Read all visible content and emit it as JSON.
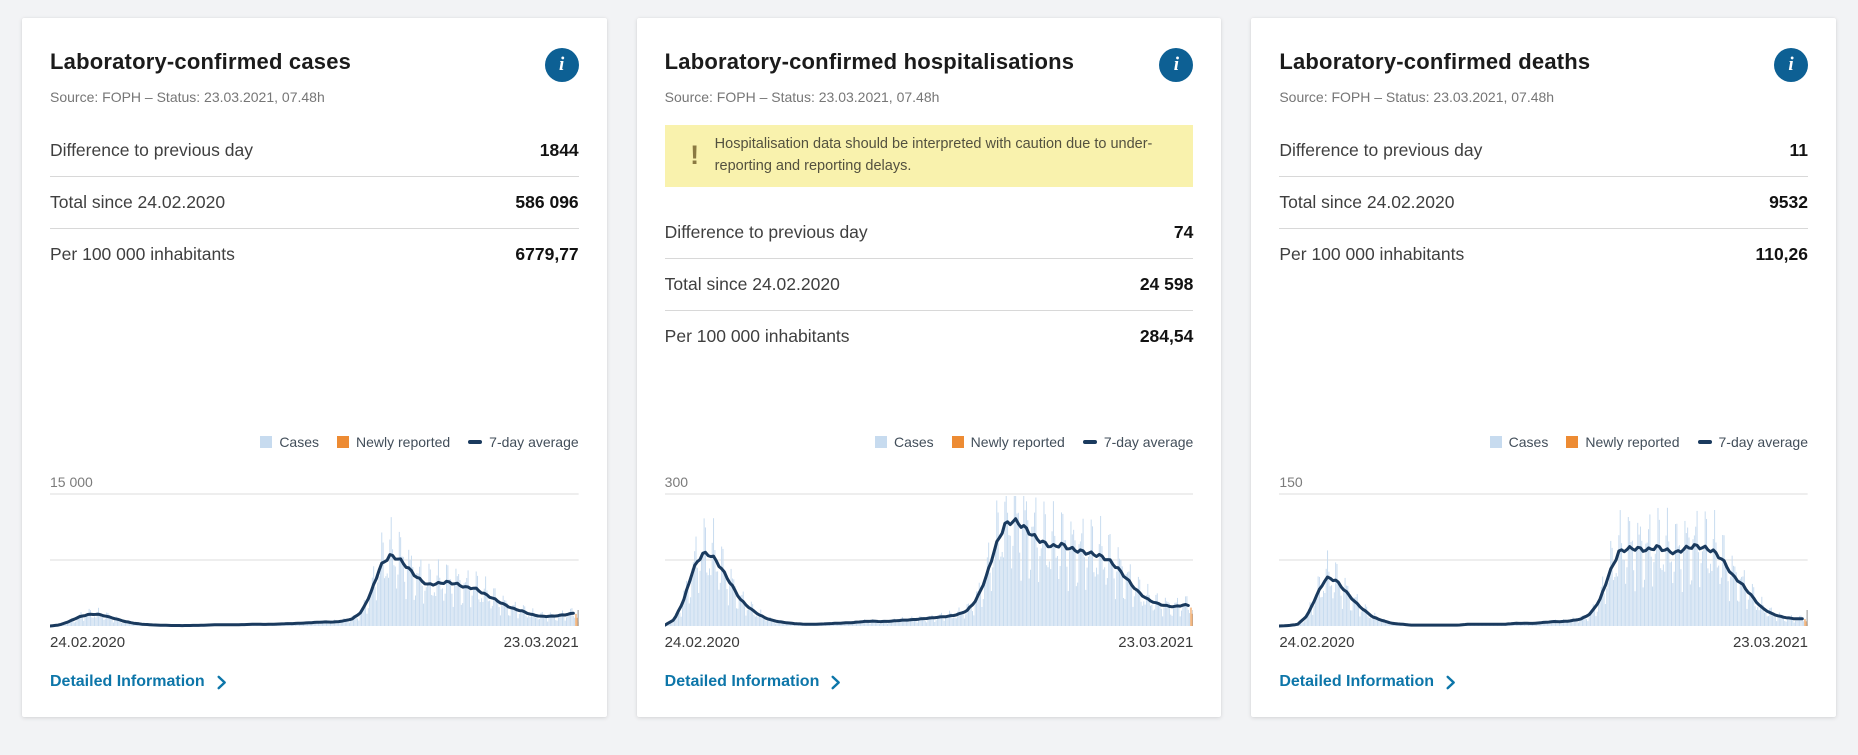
{
  "colors": {
    "page_bg": "#f2f3f5",
    "card_bg": "#ffffff",
    "info_bg": "#0d6094",
    "link_blue": "#0d76a9",
    "bars_blue": "#c7dbef",
    "newly_orange": "#ed8b33",
    "avg_navy": "#1a3a5e",
    "grid_gray": "#dedede",
    "tick_gray": "#b9b9b9",
    "warning_bg": "#f9f2ad",
    "warning_icon": "#8b7a41"
  },
  "icons": {
    "info": "i",
    "warning": "!"
  },
  "cards": [
    {
      "title": "Laboratory-confirmed cases",
      "source": "Source: FOPH – Status: 23.03.2021, 07.48h",
      "stats": [
        {
          "label": "Difference to previous day",
          "value": "1844"
        },
        {
          "label": "Total since 24.02.2020",
          "value": "586 096"
        },
        {
          "label": "Per 100 000 inhabitants",
          "value": "6779,77"
        }
      ],
      "legend": [
        {
          "label": "Cases",
          "color": "#c7dbef"
        },
        {
          "label": "Newly reported",
          "color": "#ed8b33"
        },
        {
          "label": "7-day average",
          "color": "#1a3a5e"
        }
      ],
      "link_label": "Detailed Information",
      "chart_data": {
        "type": "area",
        "title": "Laboratory-confirmed cases over time",
        "x_start_label": "24.02.2020",
        "x_end_label": "23.03.2021",
        "ymax_label": "15 000",
        "ylim": [
          0,
          15000
        ],
        "gridlines": [
          7500,
          15000
        ],
        "legend_position": "top-right",
        "series": [
          {
            "name": "7-day average",
            "sampling": "weekly estimates from 24.02.2020 to 23.03.2021",
            "values": [
              5,
              120,
              500,
              1000,
              1300,
              1350,
              1100,
              800,
              500,
              300,
              180,
              120,
              80,
              60,
              50,
              60,
              80,
              120,
              150,
              130,
              140,
              180,
              200,
              180,
              210,
              260,
              290,
              340,
              400,
              450,
              450,
              550,
              800,
              1600,
              3800,
              6800,
              8000,
              7600,
              6500,
              5400,
              4700,
              4800,
              5000,
              4800,
              4400,
              4300,
              3650,
              3100,
              2500,
              2000,
              1700,
              1300,
              1100,
              1100,
              1200,
              1350,
              1600
            ]
          }
        ],
        "bars_note": "Daily 'Cases' bars fluctuate around the 7-day average; most recent days shown as 'Newly reported' in orange"
      }
    },
    {
      "title": "Laboratory-confirmed hospitalisations",
      "source": "Source: FOPH – Status: 23.03.2021, 07.48h",
      "warning": "Hospitalisation data should be interpreted with caution due to under-reporting and reporting delays.",
      "stats": [
        {
          "label": "Difference to previous day",
          "value": "74"
        },
        {
          "label": "Total since 24.02.2020",
          "value": "24 598"
        },
        {
          "label": "Per 100 000 inhabitants",
          "value": "284,54"
        }
      ],
      "legend": [
        {
          "label": "Cases",
          "color": "#c7dbef"
        },
        {
          "label": "Newly reported",
          "color": "#ed8b33"
        },
        {
          "label": "7-day average",
          "color": "#1a3a5e"
        }
      ],
      "link_label": "Detailed Information",
      "chart_data": {
        "type": "area",
        "title": "Laboratory-confirmed hospitalisations over time",
        "x_start_label": "24.02.2020",
        "x_end_label": "23.03.2021",
        "ymax_label": "300",
        "ylim": [
          0,
          300
        ],
        "gridlines": [
          150,
          300
        ],
        "legend_position": "top-right",
        "series": [
          {
            "name": "7-day average",
            "sampling": "weekly estimates from 24.02.2020 to 23.03.2021",
            "values": [
              2,
              15,
              60,
              130,
              165,
              160,
              130,
              95,
              60,
              40,
              25,
              15,
              10,
              7,
              5,
              4,
              4,
              5,
              6,
              7,
              8,
              10,
              11,
              10,
              11,
              13,
              14,
              16,
              18,
              20,
              22,
              26,
              35,
              60,
              110,
              180,
              230,
              240,
              225,
              205,
              190,
              180,
              185,
              175,
              170,
              165,
              160,
              150,
              130,
              105,
              80,
              62,
              52,
              46,
              44,
              48,
              46
            ]
          }
        ],
        "bars_note": "Daily 'Cases' bars fluctuate around the 7-day average; most recent days shown as 'Newly reported' in orange"
      }
    },
    {
      "title": "Laboratory-confirmed deaths",
      "source": "Source: FOPH – Status: 23.03.2021, 07.48h",
      "stats": [
        {
          "label": "Difference to previous day",
          "value": "11"
        },
        {
          "label": "Total since 24.02.2020",
          "value": "9532"
        },
        {
          "label": "Per 100 000 inhabitants",
          "value": "110,26"
        }
      ],
      "legend": [
        {
          "label": "Cases",
          "color": "#c7dbef"
        },
        {
          "label": "Newly reported",
          "color": "#ed8b33"
        },
        {
          "label": "7-day average",
          "color": "#1a3a5e"
        }
      ],
      "link_label": "Detailed Information",
      "chart_data": {
        "type": "area",
        "title": "Laboratory-confirmed deaths over time",
        "x_start_label": "24.02.2020",
        "x_end_label": "23.03.2021",
        "ymax_label": "150",
        "ylim": [
          0,
          150
        ],
        "gridlines": [
          75,
          150
        ],
        "legend_position": "top-right",
        "series": [
          {
            "name": "7-day average",
            "sampling": "weekly estimates from 24.02.2020 to 23.03.2021",
            "values": [
              0,
              0.5,
              2,
              12,
              35,
              55,
              52,
              40,
              28,
              18,
              10,
              6,
              3,
              2,
              1,
              1,
              1,
              1,
              1,
              1,
              2,
              2,
              2,
              2,
              2,
              3,
              3,
              3,
              4,
              5,
              5,
              6,
              8,
              14,
              30,
              60,
              84,
              88,
              88,
              86,
              90,
              86,
              83,
              88,
              91,
              89,
              85,
              75,
              58,
              48,
              35,
              22,
              15,
              11,
              9,
              8,
              9
            ]
          }
        ],
        "bars_note": "Daily 'Cases' bars fluctuate around the 7-day average; most recent days shown as 'Newly reported' in orange"
      }
    }
  ]
}
